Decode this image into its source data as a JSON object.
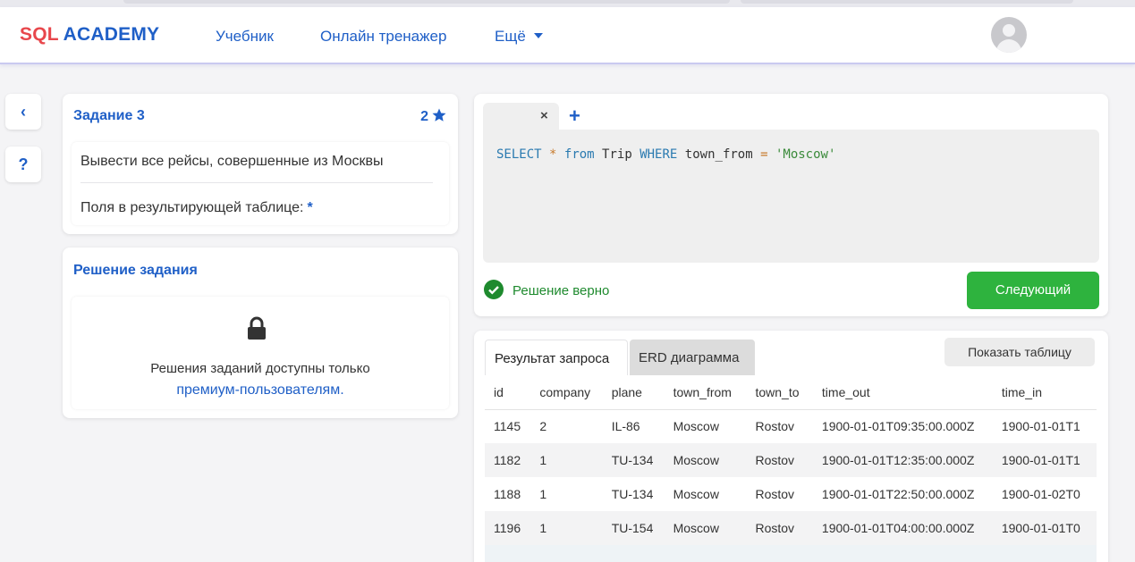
{
  "header": {
    "logo_sql": "SQL",
    "logo_academy": "ACADEMY",
    "nav": [
      "Учебник",
      "Онлайн тренажер",
      "Ещё"
    ]
  },
  "sidebar": {
    "back_icon": "‹",
    "help_icon": "?"
  },
  "task": {
    "title": "Задание 3",
    "score": "2",
    "description": "Вывести все рейсы, совершенные из Москвы",
    "fields_label": "Поля в результирующей таблице:",
    "fields_value": "*"
  },
  "solution": {
    "title": "Решение задания",
    "locked_text": "Решения заданий доступны только",
    "locked_link": "премиум-пользователям."
  },
  "editor": {
    "close_tab": "×",
    "add_tab": "+",
    "query": {
      "t1": "SELECT",
      "t2": "*",
      "t3": "from",
      "t4": "Trip",
      "t5": "WHERE",
      "t6": "town_from",
      "t7": "=",
      "t8": "'Moscow'"
    },
    "status_text": "Решение верно",
    "next_button": "Следующий"
  },
  "results": {
    "tabs": [
      "Результат запроса",
      "ERD диаграмма"
    ],
    "show_table_button": "Показать таблицу",
    "columns": [
      "id",
      "company",
      "plane",
      "town_from",
      "town_to",
      "time_out",
      "time_in"
    ],
    "rows": [
      [
        "1145",
        "2",
        "IL-86",
        "Moscow",
        "Rostov",
        "1900-01-01T09:35:00.000Z",
        "1900-01-01T1"
      ],
      [
        "1182",
        "1",
        "TU-134",
        "Moscow",
        "Rostov",
        "1900-01-01T12:35:00.000Z",
        "1900-01-01T1"
      ],
      [
        "1188",
        "1",
        "TU-134",
        "Moscow",
        "Rostov",
        "1900-01-01T22:50:00.000Z",
        "1900-01-02T0"
      ],
      [
        "1196",
        "1",
        "TU-154",
        "Moscow",
        "Rostov",
        "1900-01-01T04:00:00.000Z",
        "1900-01-01T0"
      ]
    ]
  },
  "colors": {
    "brand_blue": "#1f5fc7",
    "brand_red": "#e8474c",
    "success_green": "#2eb33e"
  }
}
